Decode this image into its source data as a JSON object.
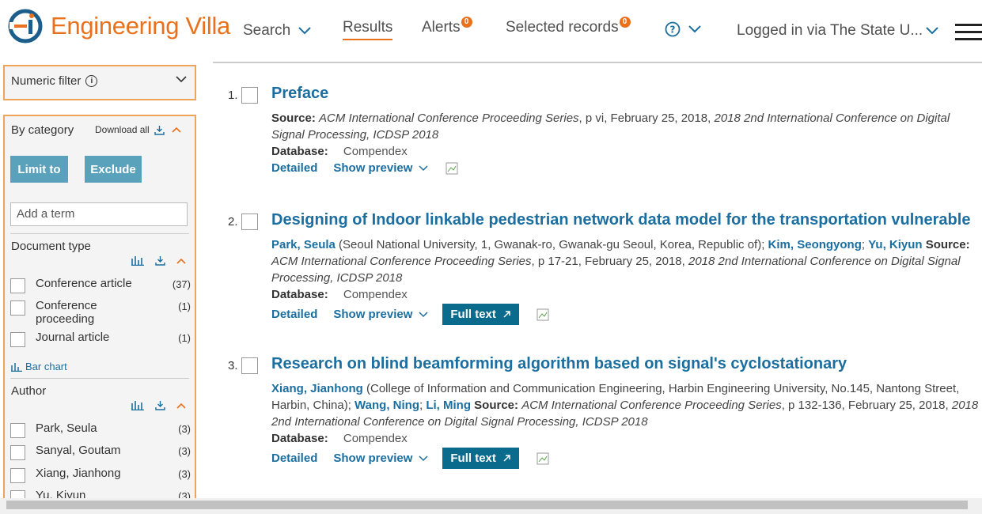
{
  "header": {
    "brand": "Engineering Villa",
    "nav": {
      "search": "Search",
      "results": "Results",
      "alerts": "Alerts",
      "alerts_count": "0",
      "selected": "Selected records",
      "selected_count": "0",
      "help": "?",
      "login": "Logged in via The State U..."
    },
    "colors": {
      "brand": "#e9711c",
      "link": "#1b6ea0",
      "button": "#5aa1bb",
      "fulltext": "#0b6b8c"
    }
  },
  "sidebar": {
    "numeric_filter": "Numeric filter",
    "by_category": "By category",
    "download_all": "Download all",
    "limit_to": "Limit to",
    "exclude": "Exclude",
    "term_placeholder": "Add a term",
    "document_type": {
      "title": "Document type",
      "items": [
        {
          "label": "Conference article",
          "count": "(37)"
        },
        {
          "label": "Conference proceeding",
          "count": "(1)"
        },
        {
          "label": "Journal article",
          "count": "(1)"
        }
      ],
      "bar_chart": "Bar chart"
    },
    "author": {
      "title": "Author",
      "items": [
        {
          "label": "Park, Seula",
          "count": "(3)"
        },
        {
          "label": "Sanyal, Goutam",
          "count": "(3)"
        },
        {
          "label": "Xiang, Jianhong",
          "count": "(3)"
        },
        {
          "label": "Yu, Kiyun",
          "count": "(3)"
        }
      ]
    }
  },
  "results": [
    {
      "num": "1.",
      "title": "Preface",
      "source_label": "Source:",
      "source": "ACM International Conference Proceeding Series",
      "source_rest": ", p vi, February 25, 2018, ",
      "conference": "2018 2nd International Conference on Digital Signal Processing, ICDSP 2018",
      "db_label": "Database:",
      "db": "Compendex",
      "detailed": "Detailed",
      "preview": "Show preview"
    },
    {
      "num": "2.",
      "title": "Designing of Indoor linkable pedestrian network data model for the transportation vulnerable",
      "author1": "Park, Seula",
      "affil1": " (Seoul National University, 1, Gwanak-ro, Gwanak-gu Seoul, Korea, Republic of); ",
      "author2": "Kim, Seongyong",
      "author3": "Yu, Kiyun",
      "source_label": "Source:",
      "source": "ACM International Conference Proceeding Series",
      "source_rest": ", p 17-21, February 25, 2018, ",
      "conference": "2018 2nd International Conference on Digital Signal Processing, ICDSP 2018",
      "db_label": "Database:",
      "db": "Compendex",
      "detailed": "Detailed",
      "preview": "Show preview",
      "fulltext": "Full text"
    },
    {
      "num": "3.",
      "title": "Research on blind beamforming algorithm based on signal's cyclostationary",
      "author1": "Xiang, Jianhong",
      "affil1": " (College of Information and Communication Engineering, Harbin Engineering University, No.145, Nantong Street, Harbin, China); ",
      "author2": "Wang, Ning",
      "author3": "Li, Ming",
      "source_label": "Source:",
      "source": "ACM International Conference Proceeding Series",
      "source_rest": ", p 132-136, February 25, 2018, ",
      "conference": "2018 2nd International Conference on Digital Signal Processing, ICDSP 2018",
      "db_label": "Database:",
      "db": "Compendex",
      "detailed": "Detailed",
      "preview": "Show preview",
      "fulltext": "Full text"
    }
  ]
}
